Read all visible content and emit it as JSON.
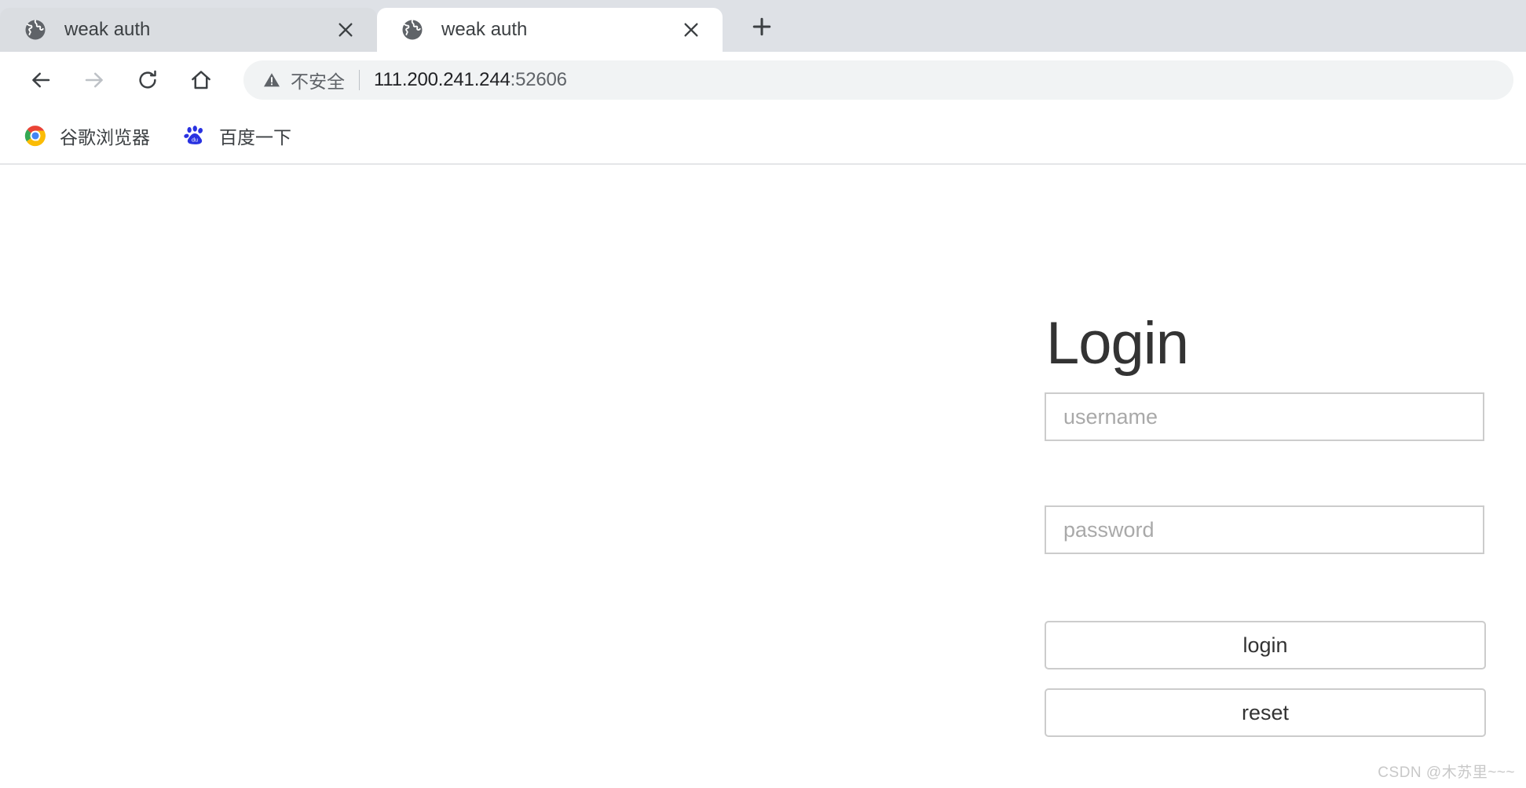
{
  "browser": {
    "tabs": [
      {
        "title": "weak auth",
        "favicon": "globe-icon",
        "active": false,
        "close_label": "×"
      },
      {
        "title": "weak auth",
        "favicon": "globe-icon",
        "active": true,
        "close_label": "×"
      }
    ],
    "new_tab_label": "+",
    "nav": {
      "back": "back-arrow-icon",
      "forward": "forward-arrow-icon",
      "reload": "reload-icon",
      "home": "home-icon"
    },
    "omnibox": {
      "security_icon": "warning-triangle-icon",
      "security_text": "不安全",
      "url_host": "111.200.241.244",
      "url_port": ":52606"
    },
    "bookmarks": [
      {
        "label": "谷歌浏览器",
        "icon": "chrome-icon"
      },
      {
        "label": "百度一下",
        "icon": "baidu-paw-icon"
      }
    ]
  },
  "page": {
    "heading": "Login",
    "username": {
      "placeholder": "username",
      "value": ""
    },
    "password": {
      "placeholder": "password",
      "value": ""
    },
    "login_label": "login",
    "reset_label": "reset",
    "watermark": "CSDN @木苏里~~~"
  },
  "colors": {
    "tabstrip_bg": "#dee1e6",
    "inactive_tab_bg": "#dadde1",
    "active_tab_bg": "#ffffff",
    "omnibox_bg": "#f1f3f4",
    "text_primary": "#202124",
    "text_secondary": "#5f6368",
    "field_border": "#cccccc",
    "placeholder": "#a9a9a9",
    "watermark": "#c8c8c8"
  }
}
